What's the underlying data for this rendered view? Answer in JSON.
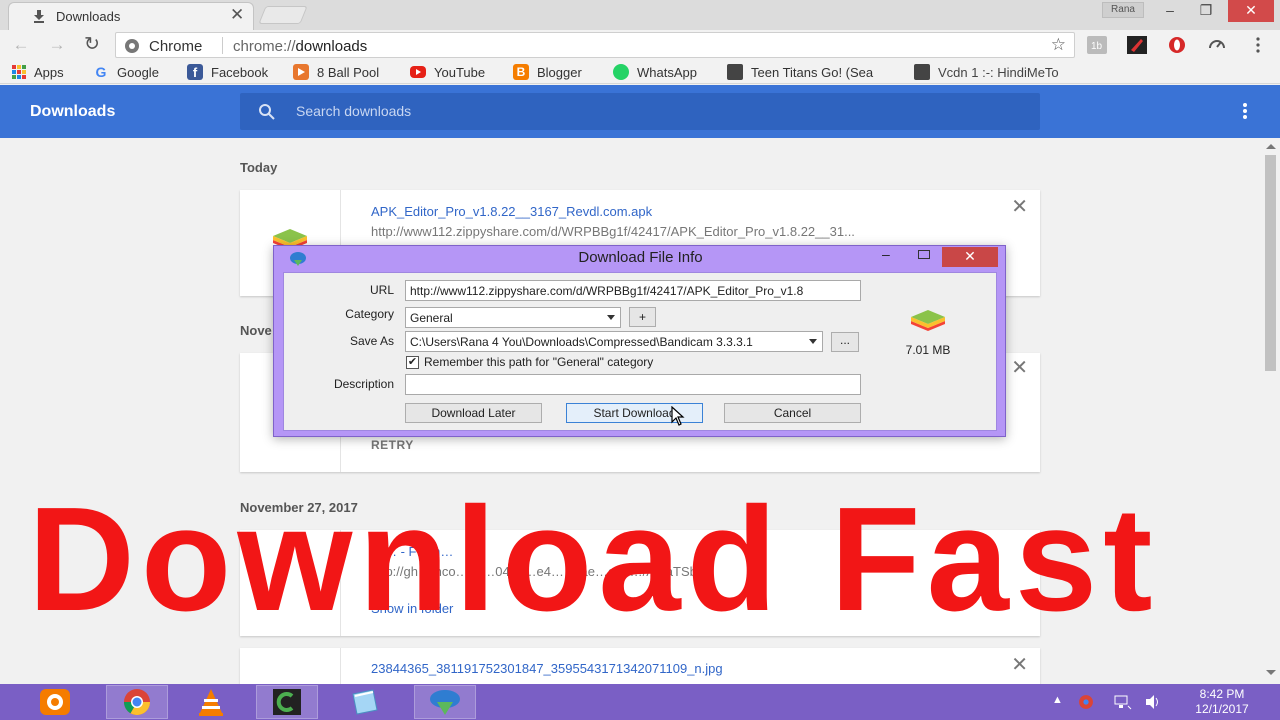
{
  "browser": {
    "tab_title": "Downloads",
    "tab_close": "✕",
    "profile_name": "Rana",
    "window_controls": {
      "minimize": "–",
      "maximize": "❐",
      "close": "✕"
    },
    "omnibox": {
      "scheme_label": "Chrome",
      "url_prefix": "chrome://",
      "url_host": "downloads"
    },
    "bookmarks": [
      {
        "label": "Apps",
        "icon": "apps-grid-icon"
      },
      {
        "label": "Google",
        "icon": "google-icon"
      },
      {
        "label": "Facebook",
        "icon": "facebook-icon"
      },
      {
        "label": "8 Ball Pool",
        "icon": "8-ball-pool-icon"
      },
      {
        "label": "YouTube",
        "icon": "youtube-icon"
      },
      {
        "label": "Blogger",
        "icon": "blogger-icon"
      },
      {
        "label": "WhatsApp",
        "icon": "whatsapp-icon"
      },
      {
        "label": "Teen Titans Go! (Sea",
        "icon": "site-icon"
      },
      {
        "label": "Vcdn 1 :-: HindiMeTo",
        "icon": "site-icon"
      }
    ]
  },
  "downloads_page": {
    "title": "Downloads",
    "search_placeholder": "Search downloads",
    "sections": [
      {
        "date": "Today",
        "items": [
          {
            "filename": "APK_Editor_Pro_v1.8.22__3167_Revdl.com.apk",
            "url": "http://www112.zippyshare.com/d/WRPBBg1f/42417/APK_Editor_Pro_v1.8.22__31..."
          }
        ]
      },
      {
        "date": "Nove",
        "items": [
          {
            "action": "RETRY"
          }
        ]
      },
      {
        "date": "November 27, 2017",
        "items": [
          {
            "filename": "Ar… - F…m…",
            "url": "http://gh… nco… c/…040c…e4… …ae…ed4…/A6IaTSb…",
            "link": "Show in folder"
          },
          {
            "filename": "23844365_381191752301847_3595543171342071109_n.jpg"
          }
        ]
      }
    ]
  },
  "dialog": {
    "title": "Download File Info",
    "url_label": "URL",
    "url_value": "http://www112.zippyshare.com/d/WRPBBg1f/42417/APK_Editor_Pro_v1.8",
    "category_label": "Category",
    "category_value": "General",
    "add_category": "+",
    "save_as_label": "Save As",
    "save_as_value": "C:\\Users\\Rana 4 You\\Downloads\\Compressed\\Bandicam 3.3.3.1",
    "browse": "...",
    "remember_label": "Remember this path for \"General\" category",
    "remember_checked": true,
    "description_label": "Description",
    "description_value": "",
    "file_size": "7.01 MB",
    "buttons": {
      "later": "Download Later",
      "start": "Start Download",
      "cancel": "Cancel"
    }
  },
  "overlay_caption": "Download Fast",
  "taskbar": {
    "apps": [
      "uc-browser-icon",
      "chrome-icon",
      "vlc-icon",
      "camtasia-icon",
      "notepad-icon",
      "idm-icon"
    ],
    "clock_time": "8:42 PM",
    "clock_date": "12/1/2017"
  },
  "colors": {
    "accent": "#3a73d6",
    "caption": "#f21616",
    "taskbar": "#7a5fc5",
    "dialog_frame": "#b596f6"
  }
}
